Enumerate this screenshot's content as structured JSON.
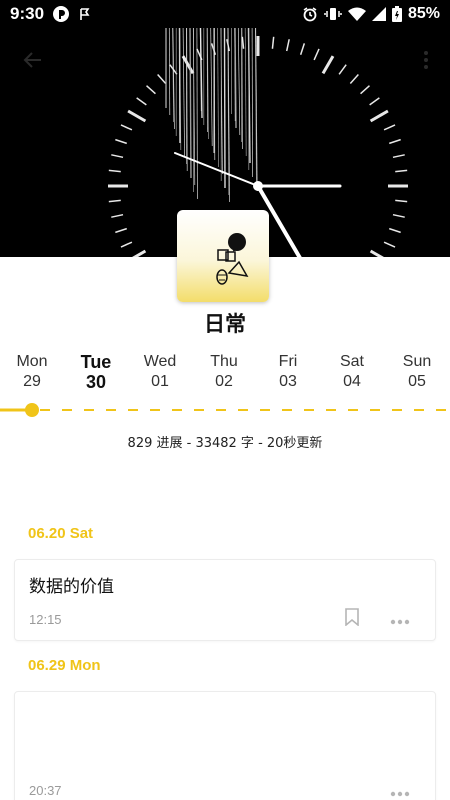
{
  "status_bar": {
    "time": "9:30",
    "battery": "85%",
    "icons": [
      "pocketcasts-icon",
      "flag-icon",
      "alarm-icon",
      "vibrate-icon",
      "wifi-icon",
      "signal-icon",
      "battery-icon"
    ]
  },
  "header": {
    "back_icon": "arrow-left-icon",
    "more_icon": "more-vertical-icon"
  },
  "notebook": {
    "title": "日常"
  },
  "week": {
    "days": [
      {
        "name": "Mon",
        "num": "29"
      },
      {
        "name": "Tue",
        "num": "30"
      },
      {
        "name": "Wed",
        "num": "01"
      },
      {
        "name": "Thu",
        "num": "02"
      },
      {
        "name": "Fri",
        "num": "03"
      },
      {
        "name": "Sat",
        "num": "04"
      },
      {
        "name": "Sun",
        "num": "05"
      }
    ],
    "selected_index": 1
  },
  "stats": {
    "text": "829 进展 - 33482 字 - 20秒更新"
  },
  "entries": [
    {
      "date": "06.20 Sat",
      "title": "数据的价值",
      "time": "12:15"
    },
    {
      "date": "06.29 Mon",
      "title": "",
      "time": "20:37"
    }
  ],
  "colors": {
    "accent": "#f0c419",
    "header_bg": "#000000"
  }
}
